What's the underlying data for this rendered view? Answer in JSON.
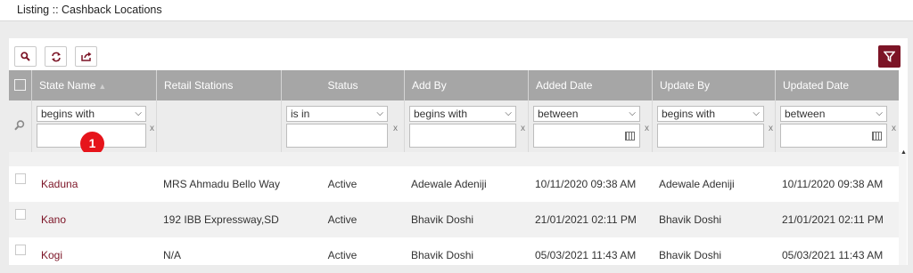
{
  "page": {
    "title": "Listing :: Cashback Locations"
  },
  "toolbar": {
    "buttons": [
      "search-icon",
      "refresh-icon",
      "export-icon"
    ],
    "filter_button": "filter-icon",
    "accent": "#7c1426"
  },
  "table": {
    "headers": [
      "State Name",
      "Retail Stations",
      "Status",
      "Add By",
      "Added Date",
      "Update By",
      "Updated Date"
    ],
    "filters": [
      {
        "operator": "begins with",
        "value": "",
        "clear": "x"
      },
      {
        "operator": "",
        "value": "",
        "clear": ""
      },
      {
        "operator": "is in",
        "value": "",
        "clear": "x"
      },
      {
        "operator": "begins with",
        "value": "",
        "clear": "x"
      },
      {
        "operator": "between",
        "value": "",
        "clear": "x"
      },
      {
        "operator": "begins with",
        "value": "",
        "clear": "x"
      },
      {
        "operator": "between",
        "value": "",
        "clear": "x"
      }
    ],
    "rows": [
      {
        "state": "Kaduna",
        "retail": "MRS Ahmadu Bello Way",
        "status": "Active",
        "add_by": "Adewale Adeniji",
        "added_date": "10/11/2020 09:38 AM",
        "update_by": "Adewale Adeniji",
        "updated_date": "10/11/2020 09:38 AM"
      },
      {
        "state": "Kano",
        "retail": "192 IBB Expressway,SD ...",
        "status": "Active",
        "add_by": "Bhavik Doshi",
        "added_date": "21/01/2021 02:11 PM",
        "update_by": "Bhavik Doshi",
        "updated_date": "21/01/2021 02:11 PM"
      },
      {
        "state": "Kogi",
        "retail": "N/A",
        "status": "Active",
        "add_by": "Bhavik Doshi",
        "added_date": "05/03/2021 11:43 AM",
        "update_by": "Bhavik Doshi",
        "updated_date": "05/03/2021 11:43 AM"
      }
    ]
  },
  "annotation": {
    "step_number": "1",
    "color": "#e6141b"
  }
}
